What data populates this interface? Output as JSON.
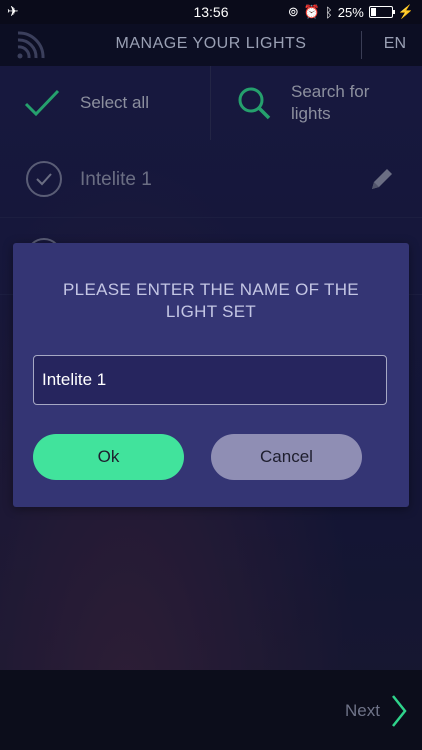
{
  "status_bar": {
    "time": "13:56",
    "battery": "25%"
  },
  "header": {
    "title": "MANAGE YOUR LIGHTS",
    "language": "EN"
  },
  "toolbar": {
    "select_all": "Select all",
    "search_line1": "Search for",
    "search_line2": "lights"
  },
  "light_list": [
    {
      "label": "Intelite 1"
    }
  ],
  "dialog": {
    "message_line1": "PLEASE ENTER THE NAME OF THE",
    "message_line2": "LIGHT SET",
    "input_value": "Intelite 1",
    "ok_label": "Ok",
    "cancel_label": "Cancel"
  },
  "footer": {
    "next_label": "Next"
  },
  "colors": {
    "accent_green": "#41e39c",
    "dialog_bg": "#343574",
    "cancel_button": "#8f8eb4"
  },
  "icons": [
    "airplane-icon",
    "wifi-icon",
    "checkmark-icon",
    "search-icon",
    "pencil-icon",
    "chevron-right-icon"
  ]
}
